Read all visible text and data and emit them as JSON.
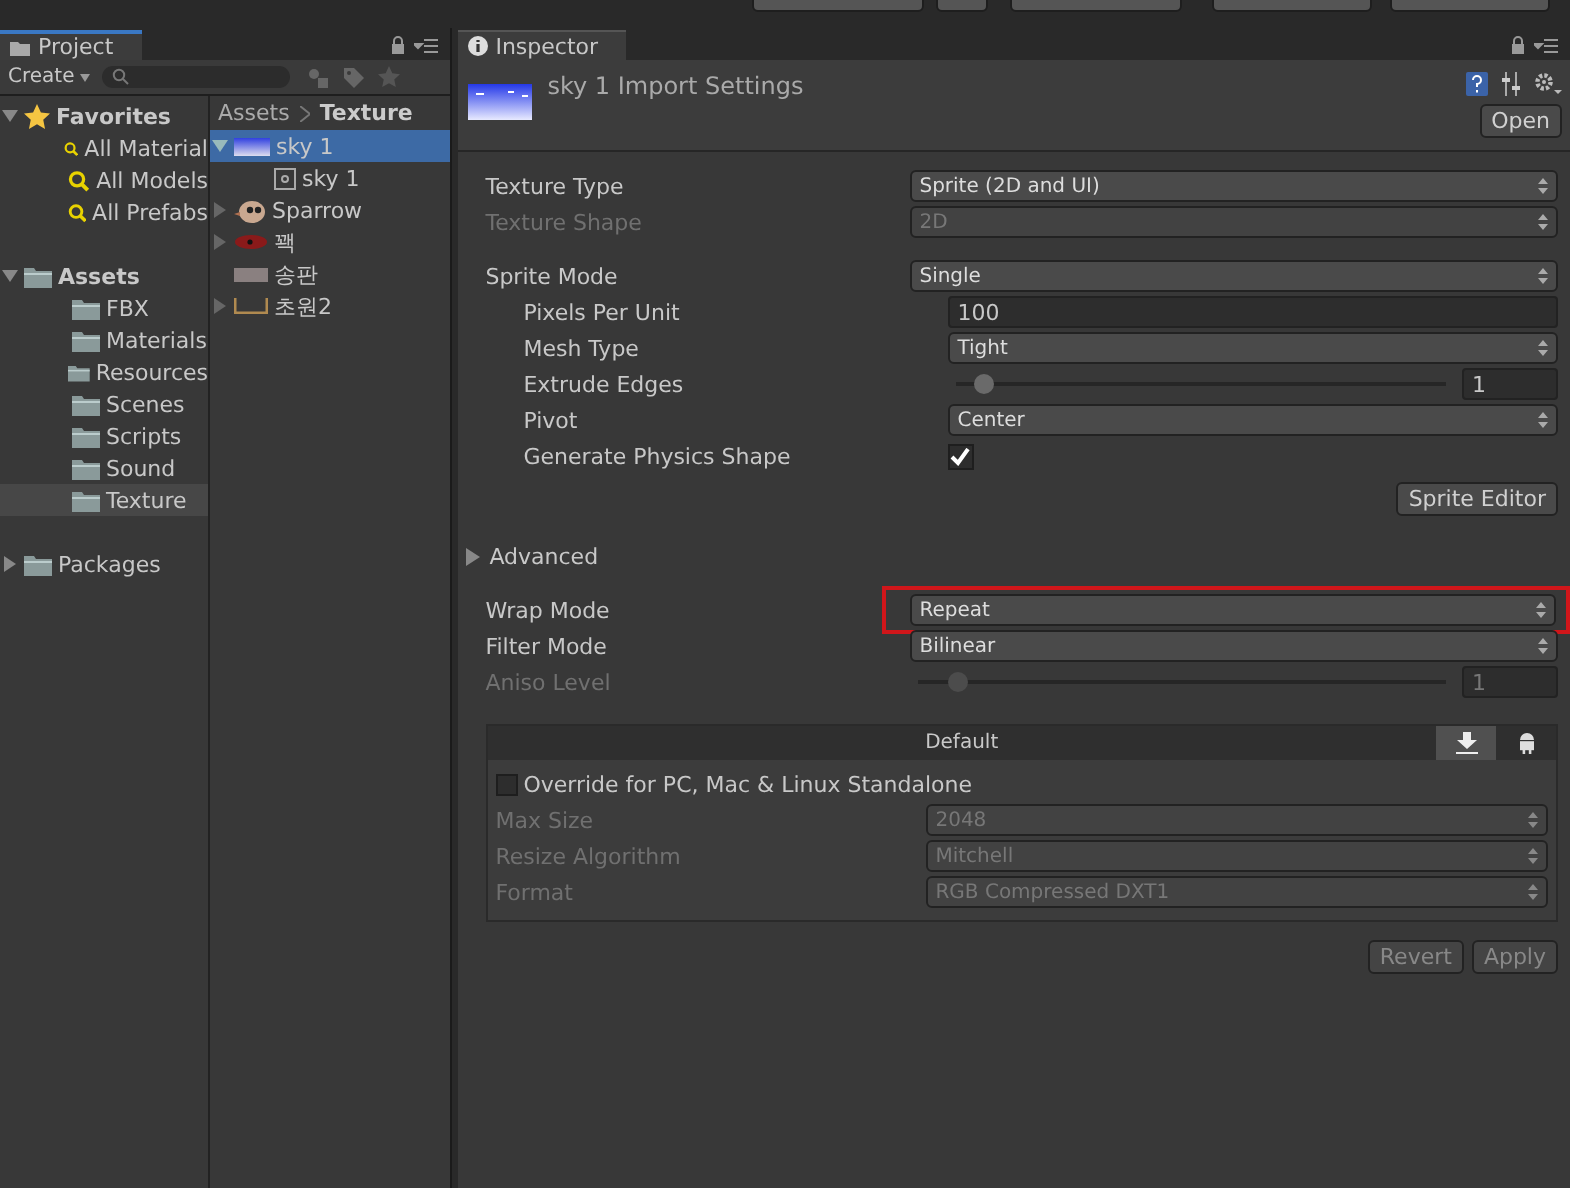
{
  "project": {
    "tab": "Project",
    "create": "Create",
    "tree": [
      {
        "label": "Favorites",
        "kind": "favorites",
        "expanded": true,
        "selected": false,
        "children": [
          {
            "label": "All Material",
            "kind": "search",
            "selected": false
          },
          {
            "label": "All Models",
            "kind": "search",
            "selected": false
          },
          {
            "label": "All Prefabs",
            "kind": "search",
            "selected": false
          }
        ]
      },
      {
        "label": "Assets",
        "kind": "folder",
        "expanded": true,
        "selected": false,
        "children": [
          {
            "label": "FBX",
            "kind": "folder",
            "selected": false
          },
          {
            "label": "Materials",
            "kind": "folder",
            "selected": false
          },
          {
            "label": "Resources",
            "kind": "folder",
            "selected": false
          },
          {
            "label": "Scenes",
            "kind": "folder",
            "selected": false
          },
          {
            "label": "Scripts",
            "kind": "folder",
            "selected": false
          },
          {
            "label": "Sound",
            "kind": "folder",
            "selected": false
          },
          {
            "label": "Texture",
            "kind": "folder",
            "selected": true
          }
        ]
      },
      {
        "label": "Packages",
        "kind": "folder",
        "expanded": false,
        "selected": false
      }
    ],
    "breadcrumb": [
      "Assets",
      "Texture"
    ],
    "files": [
      {
        "label": "sky 1",
        "kind": "sky",
        "expanded": true,
        "selected": true,
        "children": [
          {
            "label": "sky 1",
            "kind": "sprite",
            "selected": false
          }
        ]
      },
      {
        "label": "Sparrow",
        "kind": "bird",
        "expanded": false,
        "selected": false
      },
      {
        "label": "꽥",
        "kind": "red",
        "expanded": false,
        "selected": false
      },
      {
        "label": "송판",
        "kind": "plank",
        "selected": false
      },
      {
        "label": "초원2",
        "kind": "grass",
        "expanded": false,
        "selected": false
      }
    ]
  },
  "inspector": {
    "tab": "Inspector",
    "title": "sky 1 Import Settings",
    "open_button": "Open",
    "sections": [
      [
        {
          "kind": "dropdown",
          "label": "Texture Type",
          "value": "Sprite (2D and UI)",
          "disabled": false
        },
        {
          "kind": "dropdown",
          "label": "Texture Shape",
          "value": "2D",
          "disabled": true
        }
      ],
      [
        {
          "kind": "dropdown",
          "label": "Sprite Mode",
          "value": "Single",
          "disabled": false,
          "children": [
            {
              "kind": "text",
              "label": "Pixels Per Unit",
              "value": "100",
              "disabled": false
            },
            {
              "kind": "dropdown",
              "label": "Mesh Type",
              "value": "Tight",
              "disabled": false
            },
            {
              "kind": "slider",
              "label": "Extrude Edges",
              "value": "1",
              "level": 0.04,
              "disabled": false
            },
            {
              "kind": "dropdown",
              "label": "Pivot",
              "value": "Center",
              "disabled": false
            },
            {
              "kind": "checkbox",
              "label": "Generate Physics Shape",
              "checked": true,
              "disabled": false
            }
          ]
        },
        {
          "kind": "button",
          "label": "Sprite Editor",
          "disabled": false
        }
      ],
      [
        {
          "kind": "foldout",
          "label": "Advanced",
          "expanded": false
        }
      ],
      [
        {
          "kind": "dropdown",
          "label": "Wrap Mode",
          "value": "Repeat",
          "disabled": false,
          "highlighted": true
        },
        {
          "kind": "dropdown",
          "label": "Filter Mode",
          "value": "Bilinear",
          "disabled": false
        },
        {
          "kind": "slider",
          "label": "Aniso Level",
          "value": "1",
          "level": 0.06,
          "disabled": true
        }
      ]
    ],
    "platform": {
      "header": "Default",
      "tabs": [
        {
          "kind": "download",
          "selected": true
        },
        {
          "kind": "android",
          "selected": false
        }
      ],
      "override": {
        "label": "Override for PC, Mac & Linux Standalone",
        "checked": false
      },
      "fields": [
        {
          "label": "Max Size",
          "value": "2048",
          "disabled": true
        },
        {
          "label": "Resize Algorithm",
          "value": "Mitchell",
          "disabled": true
        },
        {
          "label": "Format",
          "value": "RGB Compressed DXT1",
          "disabled": true
        }
      ]
    },
    "buttons": [
      {
        "label": "Revert",
        "disabled": true
      },
      {
        "label": "Apply",
        "disabled": true
      }
    ]
  }
}
